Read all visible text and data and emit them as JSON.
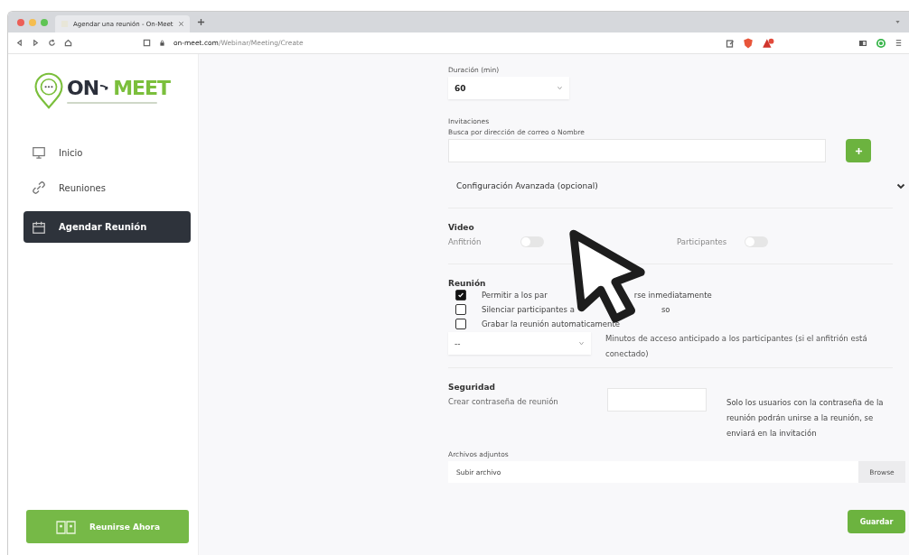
{
  "browser": {
    "tab_title": "Agendar una reunión - On-Meet",
    "url_host": "on-meet.com",
    "url_path": "/Webinar/Meeting/Create"
  },
  "sidebar": {
    "logo": {
      "part_1": "ON",
      "part_2": "MEET"
    },
    "items": [
      {
        "label": "Inicio",
        "selected": false
      },
      {
        "label": "Reuniones",
        "selected": false
      },
      {
        "label": "Agendar Reunión",
        "selected": true
      }
    ],
    "join_button": "Reunirse Ahora"
  },
  "form": {
    "duration": {
      "label": "Duración (min)",
      "value": "60"
    },
    "invitations": {
      "label": "Invitaciones",
      "hint": "Busca por dirección de correo o Nombre"
    },
    "advanced": {
      "label": "Configuración Avanzada (opcional)",
      "expanded": false
    },
    "video": {
      "title": "Video",
      "toggles": [
        {
          "label": "Anfitrión",
          "on": false
        },
        {
          "label": "Participantes",
          "on": false
        }
      ]
    },
    "meeting": {
      "title": "Reunión",
      "options": [
        {
          "parts": [
            "Permitir a los par",
            "rse inmediatamente"
          ],
          "checked": true
        },
        {
          "parts": [
            "Silenciar participantes a",
            "so"
          ],
          "checked": false
        },
        {
          "parts": [
            "Grabar la reunión automaticamente"
          ],
          "checked": false
        }
      ],
      "early_access": {
        "value": "--",
        "label": "Minutos de acceso anticipado a los participantes (si el anfitrión está conectado)"
      }
    },
    "security": {
      "title": "Seguridad",
      "password_label": "Crear contraseña de reunión",
      "note": "Solo los usuarios con la contraseña de la reunión podrán unirse a la reunión, se enviará en la invitación"
    },
    "attachments": {
      "label": "Archivos adjuntos",
      "placeholder": "Subir archivo",
      "browse": "Browse"
    },
    "save_button": "Guardar"
  }
}
